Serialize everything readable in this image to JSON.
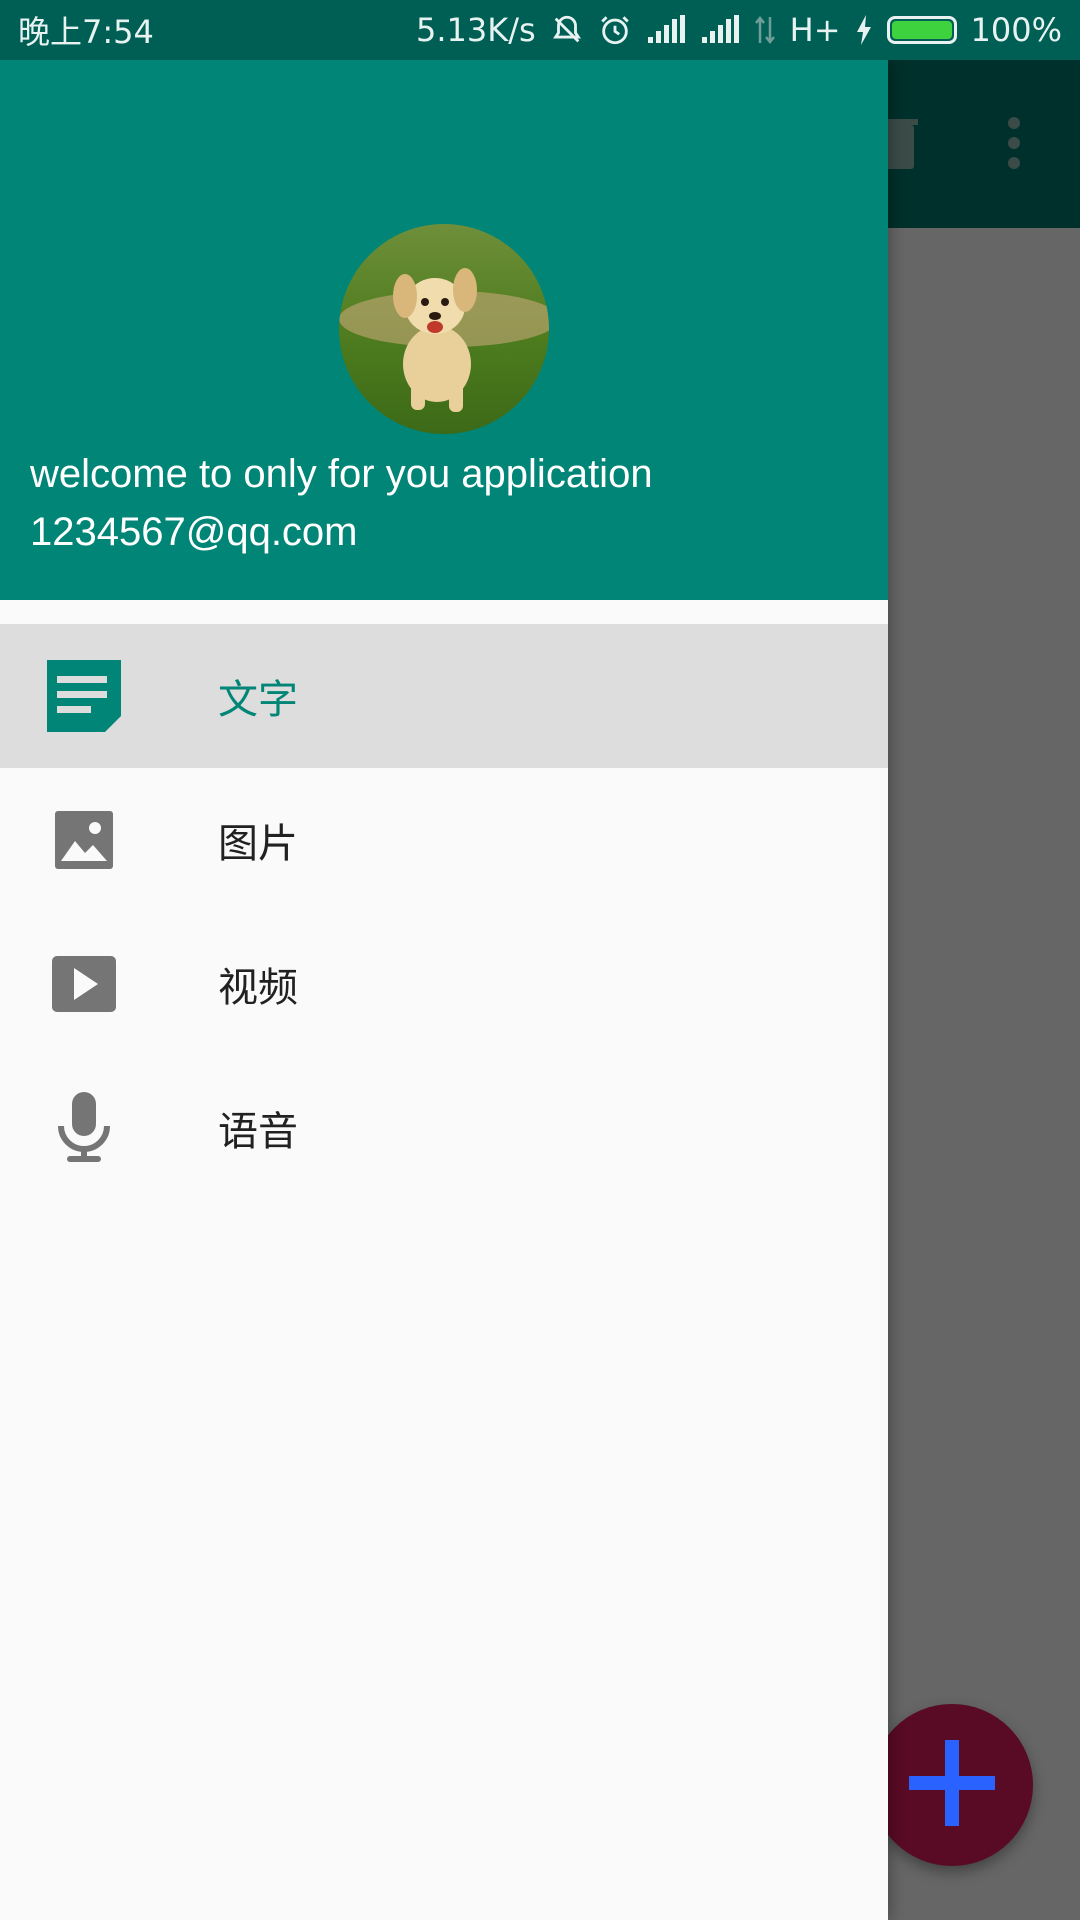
{
  "status_bar": {
    "time": "晚上7:54",
    "speed": "5.13K/s",
    "network": "H+",
    "battery_level": 1.0,
    "battery_text": "100%",
    "battery_color": "#3fd23f"
  },
  "colors": {
    "primary": "#008577",
    "primary_dark": "#005f55",
    "fab": "#590a24",
    "fab_icon": "#2962ff",
    "active_bg": "#dddddd"
  },
  "toolbar": {
    "delete_icon": "trash-icon",
    "more_icon": "more-vert-icon"
  },
  "drawer": {
    "header": {
      "avatar": "dog-avatar",
      "welcome": "welcome to only for you application",
      "email": "1234567@qq.com"
    },
    "menu": [
      {
        "label": "文字",
        "icon": "notes-icon",
        "active": true
      },
      {
        "label": "图片",
        "icon": "image-icon",
        "active": false
      },
      {
        "label": "视频",
        "icon": "video-icon",
        "active": false
      },
      {
        "label": "语音",
        "icon": "mic-icon",
        "active": false
      }
    ]
  },
  "fab": {
    "icon": "plus-icon"
  }
}
